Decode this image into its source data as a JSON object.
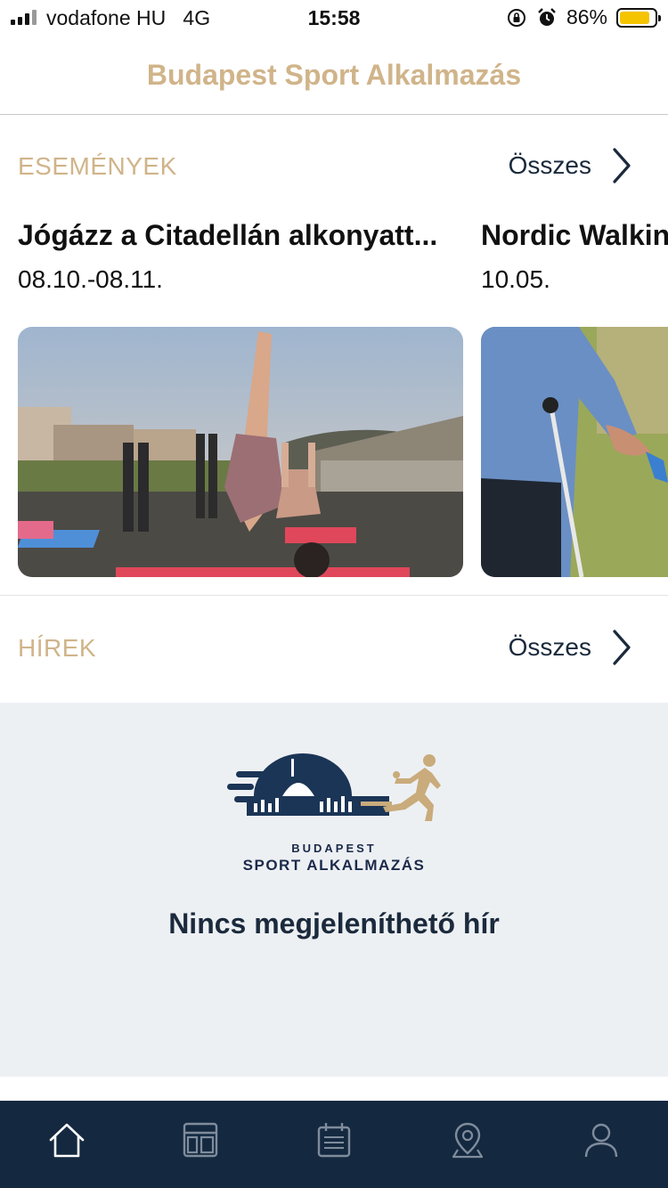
{
  "status_bar": {
    "carrier": "vodafone HU",
    "network": "4G",
    "time": "15:58",
    "battery_percent_text": "86%",
    "battery_level": 0.86,
    "icons": [
      "signal-icon",
      "rotation-lock-icon",
      "alarm-icon",
      "battery-icon"
    ]
  },
  "header": {
    "title": "Budapest Sport Alkalmazás"
  },
  "events": {
    "section_title": "ESEMÉNYEK",
    "all_label": "Összes",
    "items": [
      {
        "title": "Jógázz a Citadellán alkonyatt...",
        "date": "08.10.-08.11.",
        "image": "yoga-rooftop-photo"
      },
      {
        "title": "Nordic Walkin",
        "date": "10.05.",
        "image": "nordic-walking-photo"
      }
    ]
  },
  "news": {
    "section_title": "HÍREK",
    "all_label": "Összes",
    "empty_message": "Nincs megjeleníthető hír",
    "logo": {
      "line1": "BUDAPEST",
      "line2": "SPORT ALKALMAZÁS"
    }
  },
  "tabbar": {
    "tabs": [
      {
        "icon": "home-icon",
        "active": true
      },
      {
        "icon": "dashboard-icon",
        "active": false
      },
      {
        "icon": "calendar-icon",
        "active": false
      },
      {
        "icon": "map-pin-icon",
        "active": false
      },
      {
        "icon": "profile-icon",
        "active": false
      }
    ]
  },
  "colors": {
    "accent": "#d0b48a",
    "navy": "#142940",
    "text_dark": "#1b2a3c",
    "empty_bg": "#edf0f3",
    "battery": "#f5c400"
  }
}
